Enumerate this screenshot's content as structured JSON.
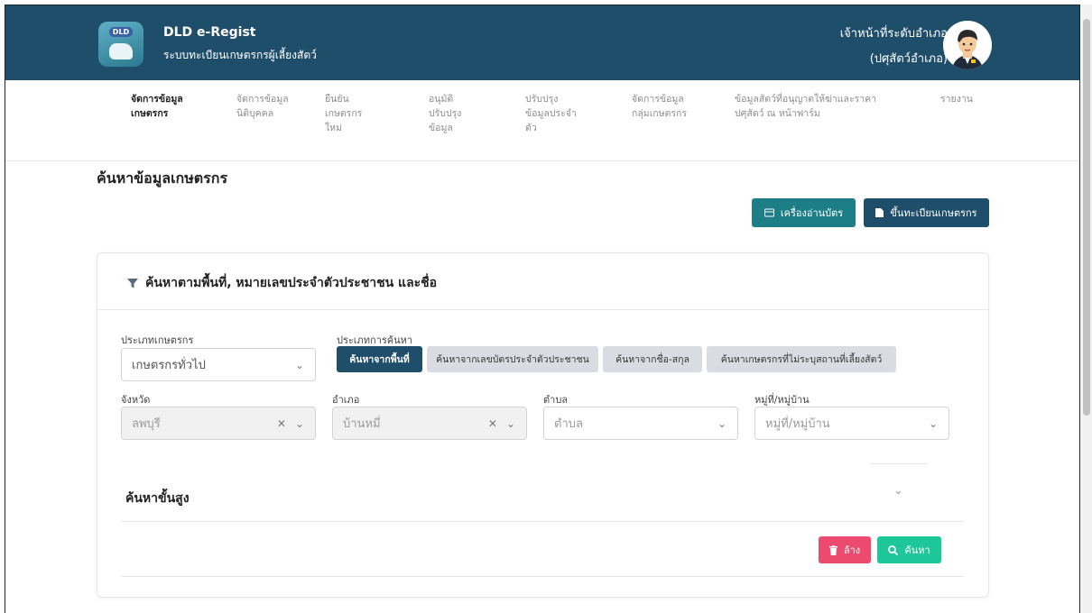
{
  "header": {
    "logo_text": "DLD",
    "app_title": "DLD e-Regist",
    "app_subtitle": "ระบบทะเบียนเกษตรกรผู้เลี้ยงสัตว์",
    "user_role": "เจ้าหน้าที่ระดับอำเภอ",
    "user_office": "(ปศุสัตว์อำเภอ)"
  },
  "nav": {
    "items": [
      {
        "label": "จัดการข้อมูล\nเกษตรกร",
        "active": true
      },
      {
        "label": "จัดการข้อมูล\nนิติบุคคล",
        "active": false
      },
      {
        "label": "ยืนยัน\nเกษตรกร\nใหม่",
        "active": false
      },
      {
        "label": "อนุมัติ\nปรับปรุง\nข้อมูล",
        "active": false
      },
      {
        "label": "ปรับปรุง\nข้อมูลประจำ\nตัว",
        "active": false
      },
      {
        "label": "จัดการข้อมูล\nกลุ่มเกษตรกร",
        "active": false
      },
      {
        "label": "ข้อมูลสัตว์ที่อนุญาตให้ฆ่าและราคา\nปศุสัตว์ ณ หน้าฟาร์ม",
        "active": false
      },
      {
        "label": "รายงาน",
        "active": false
      }
    ]
  },
  "page": {
    "title": "ค้นหาข้อมูลเกษตรกร",
    "card_reader_button": "เครื่องอ่านบัตร",
    "register_button": "ขึ้นทะเบียนเกษตรกร"
  },
  "search": {
    "card_title": "ค้นหาตามพื้นที่, หมายเลขประจำตัวประชาชน และชื่อ",
    "farmer_type_label": "ประเภทเกษตรกร",
    "farmer_type_value": "เกษตรกรทั่วไป",
    "search_type_label": "ประเภทการค้นหา",
    "search_types": [
      "ค้นหาจากพื้นที่",
      "ค้นหาจากเลขบัตรประจำตัวประชาชน",
      "ค้นหาจากชื่อ-สกุล",
      "ค้นหาเกษตรกรที่ไม่ระบุสถานที่เลี้ยงสัตว์"
    ],
    "province_label": "จังหวัด",
    "province_value": "ลพบุรี",
    "district_label": "อำเภอ",
    "district_value": "บ้านหมี่",
    "subdistrict_label": "ตำบล",
    "subdistrict_placeholder": "ตำบล",
    "village_label": "หมู่ที่/หมู่บ้าน",
    "village_placeholder": "หมู่ที่/หมู่บ้าน",
    "advanced_label": "ค้นหาขั้นสูง",
    "clear_button": "ล้าง",
    "search_button": "ค้นหา"
  },
  "colors": {
    "header_bg": "#1f4e6b",
    "teal_button": "#1e7e88",
    "clear_button": "#ec4a6e",
    "search_button": "#1ec79a"
  }
}
